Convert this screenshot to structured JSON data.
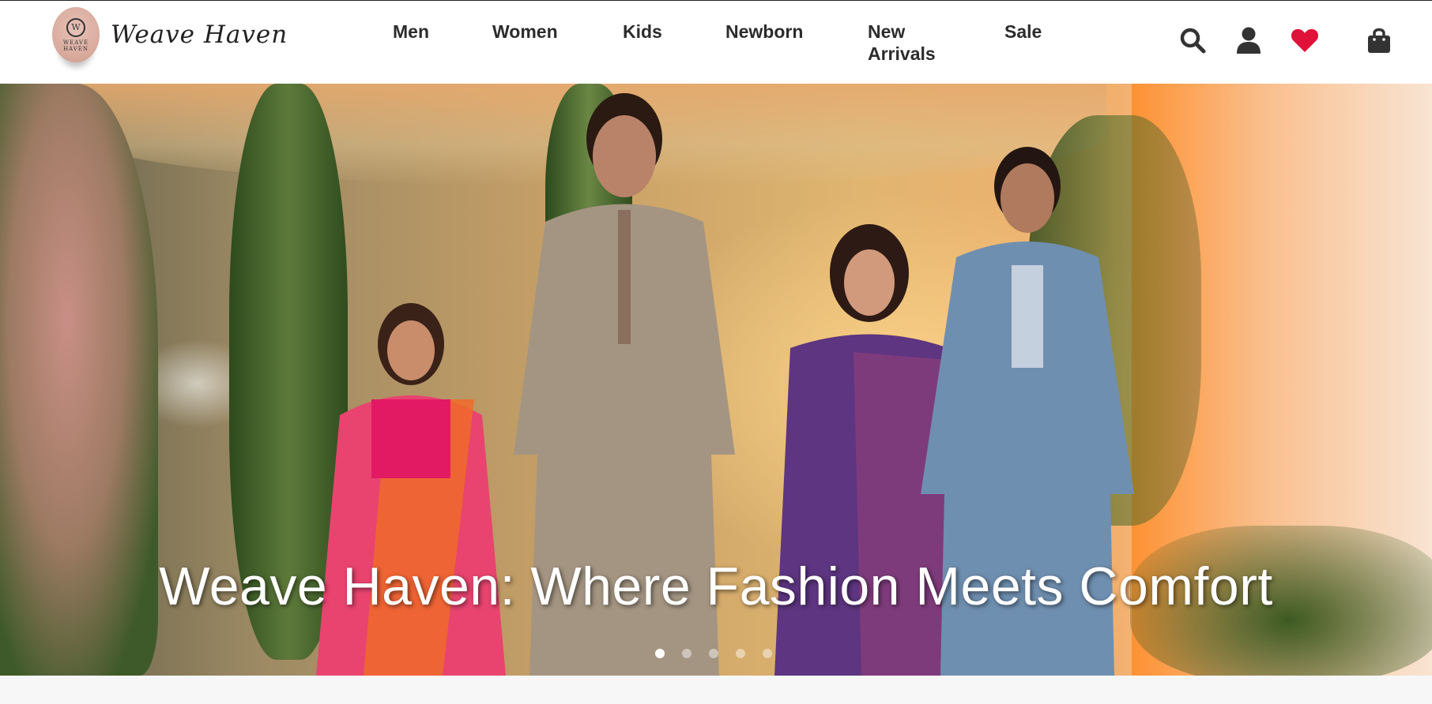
{
  "brand": {
    "name": "Weave Haven",
    "badge_text": "WEAVE HAVEN",
    "badge_mark": "W"
  },
  "nav": {
    "items": [
      {
        "label": "Men"
      },
      {
        "label": "Women"
      },
      {
        "label": "Kids"
      },
      {
        "label": "Newborn"
      },
      {
        "label": "New Arrivals"
      },
      {
        "label": "Sale"
      }
    ]
  },
  "header_icons": [
    {
      "name": "search-icon"
    },
    {
      "name": "user-icon"
    },
    {
      "name": "heart-icon",
      "color": "#e0123a"
    },
    {
      "name": "shopping-bag-icon"
    }
  ],
  "hero": {
    "caption": "Weave Haven: Where Fashion Meets Comfort",
    "slide_count": 5,
    "active_slide": 1
  },
  "colors": {
    "nav_text": "#2c2c2c",
    "accent_heart": "#e0123a",
    "caption_text": "#ffffff"
  }
}
